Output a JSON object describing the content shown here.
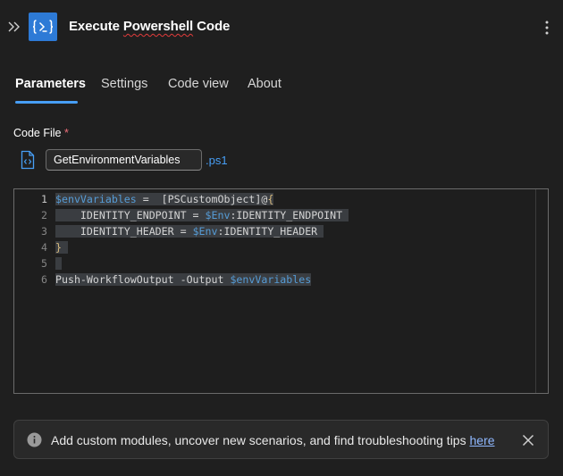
{
  "header": {
    "title_part1": "Execute ",
    "title_part2": "Powershell",
    "title_part3": " Code",
    "icon": "powershell-icon",
    "collapse_icon": "double-chevron-right-icon",
    "more_icon": "more-vertical-icon"
  },
  "tabs": [
    {
      "label": "Parameters",
      "active": true
    },
    {
      "label": "Settings",
      "active": false
    },
    {
      "label": "Code view",
      "active": false
    },
    {
      "label": "About",
      "active": false
    }
  ],
  "code_file": {
    "label": "Code File",
    "required_mark": "*",
    "value": "GetEnvironmentVariables",
    "extension": ".ps1",
    "icon": "code-file-icon"
  },
  "editor": {
    "lines": [
      {
        "number": "1",
        "current": true
      },
      {
        "number": "2"
      },
      {
        "number": "3"
      },
      {
        "number": "4"
      },
      {
        "number": "5"
      },
      {
        "number": "6"
      }
    ]
  },
  "notice": {
    "text": "Add custom modules, uncover new scenarios, and find troubleshooting tips ",
    "link_text": "here",
    "icon": "info-icon",
    "close_icon": "close-icon"
  },
  "colors": {
    "accent": "#479ef5",
    "icon_bg": "#2d7ad6",
    "background": "#1f1f1f",
    "code_variable": "#569cd6",
    "code_brace": "#d7ba7d",
    "required": "#f1707b"
  }
}
